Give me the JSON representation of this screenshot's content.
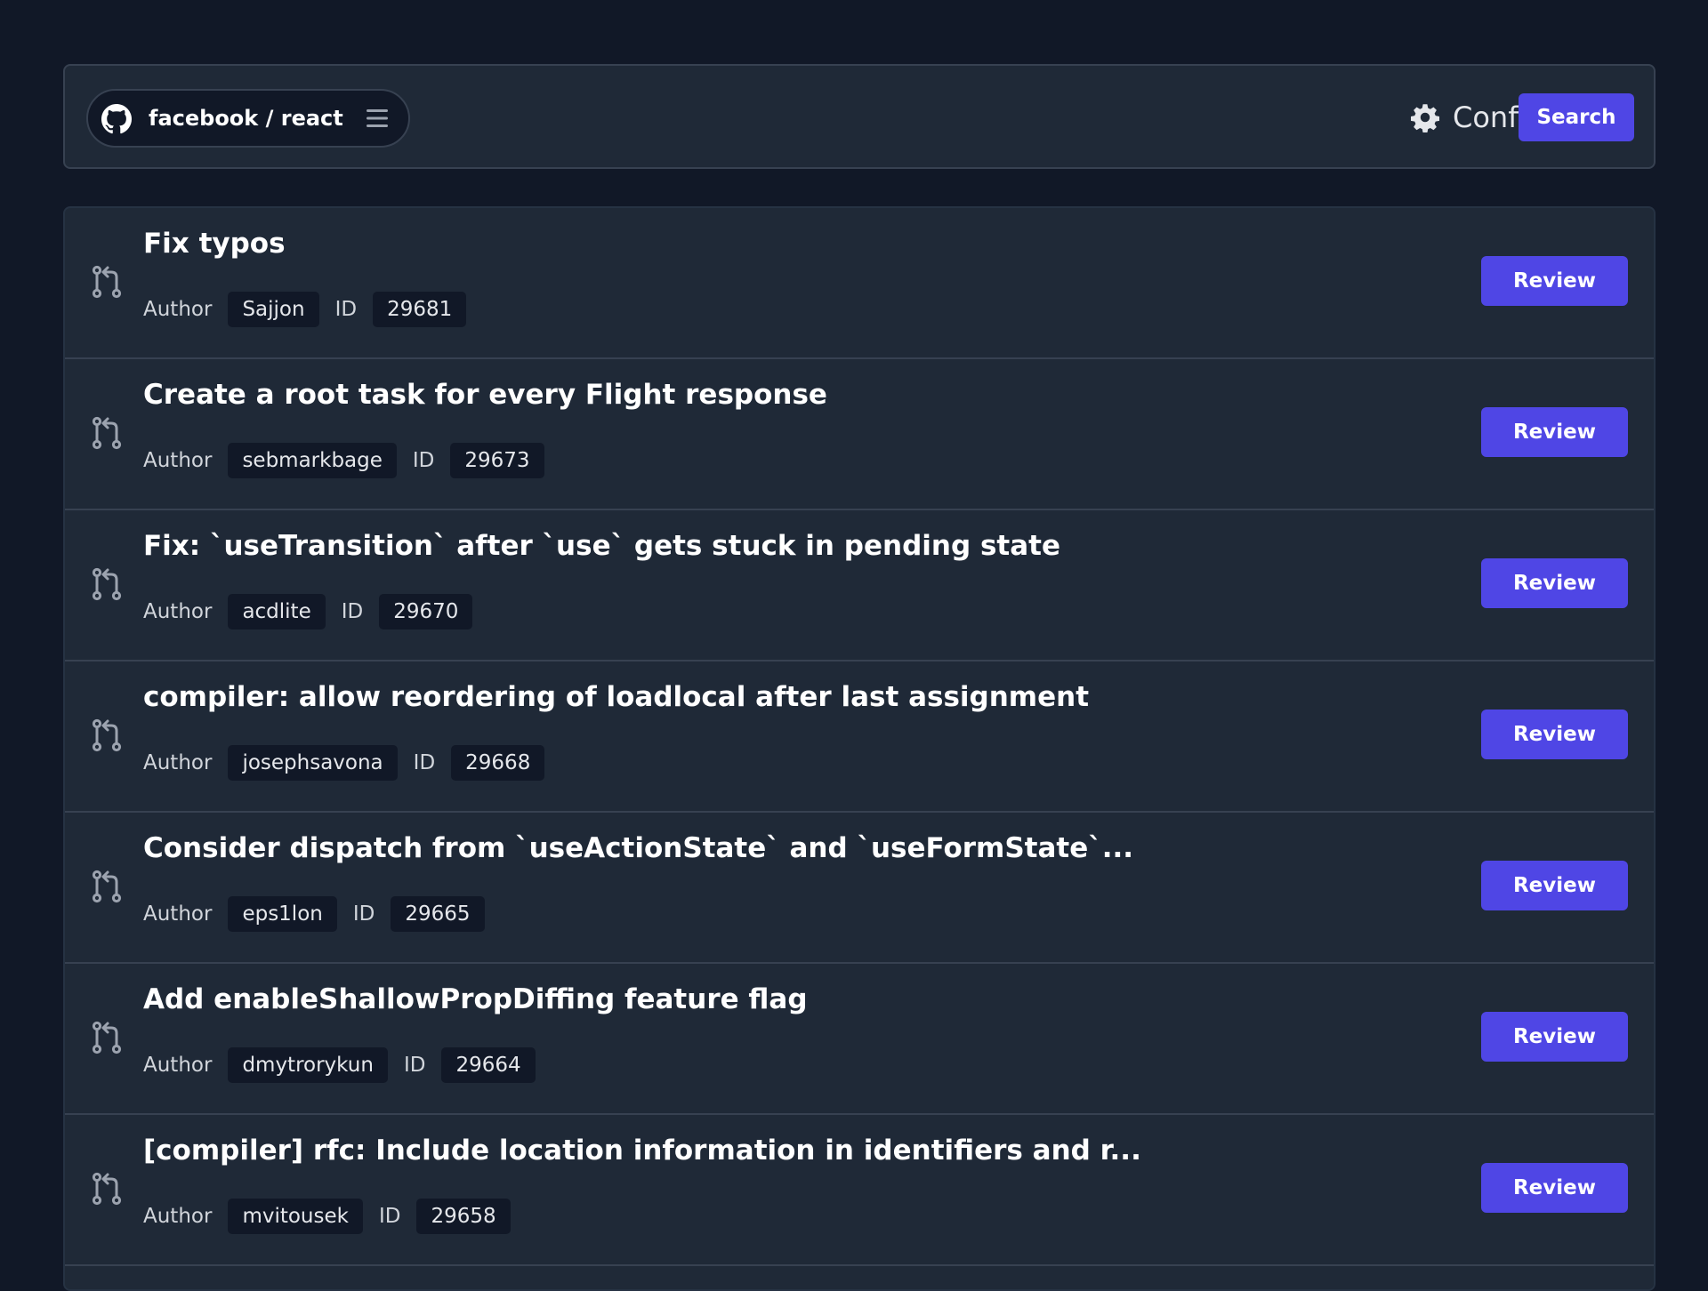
{
  "header": {
    "repo_owner": "facebook",
    "repo_separator": "/",
    "repo_name": "react",
    "repo_label": "facebook / react",
    "icons": {
      "repo": "github-icon",
      "menu": "menu-icon",
      "config": "gear-icon"
    },
    "config_label": "Config",
    "search_label": "Search"
  },
  "colors": {
    "page_background": "#111827",
    "panel_background": "#1f2937",
    "chip_background": "#111827",
    "accent": "#4f46e5",
    "border": "#374151",
    "muted_text": "#d1d5db",
    "icon": "#9ca3af"
  },
  "pull_requests": {
    "author_label": "Author",
    "id_label": "ID",
    "review_label": "Review",
    "item_icon": "pull-request-icon",
    "items": [
      {
        "title": "Fix typos",
        "author": "Sajjon",
        "id": "29681"
      },
      {
        "title": "Create a root task for every Flight response",
        "author": "sebmarkbage",
        "id": "29673"
      },
      {
        "title": "Fix: `useTransition` after `use` gets stuck in pending state",
        "author": "acdlite",
        "id": "29670"
      },
      {
        "title": "compiler: allow reordering of loadlocal after last assignment",
        "author": "josephsavona",
        "id": "29668"
      },
      {
        "title": "Consider dispatch from `useActionState` and `useFormState`...",
        "author": "eps1lon",
        "id": "29665"
      },
      {
        "title": "Add enableShallowPropDiffing feature flag",
        "author": "dmytrorykun",
        "id": "29664"
      },
      {
        "title": "[compiler] rfc: Include location information in identifiers and r...",
        "author": "mvitousek",
        "id": "29658"
      }
    ]
  }
}
